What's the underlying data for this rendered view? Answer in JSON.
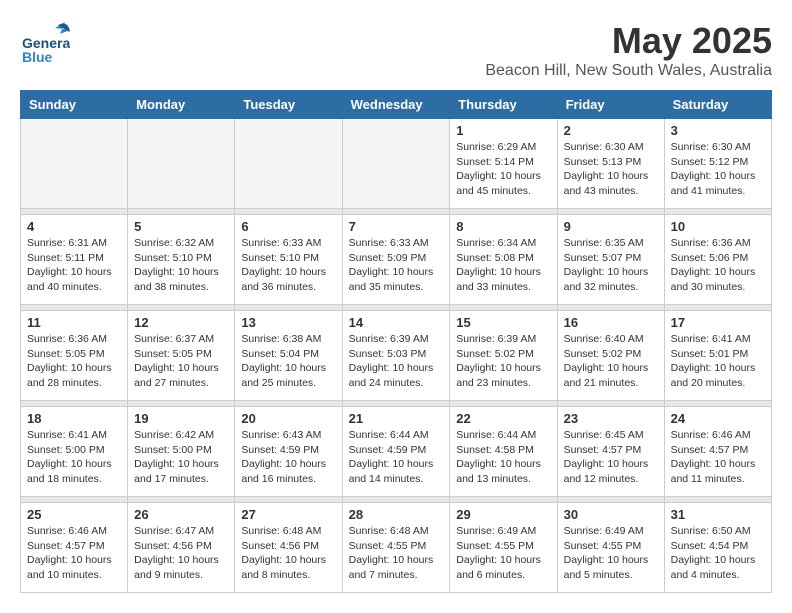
{
  "header": {
    "logo": {
      "line1": "General",
      "line2": "Blue"
    },
    "title": "May 2025",
    "location": "Beacon Hill, New South Wales, Australia"
  },
  "weekdays": [
    "Sunday",
    "Monday",
    "Tuesday",
    "Wednesday",
    "Thursday",
    "Friday",
    "Saturday"
  ],
  "weeks": [
    [
      {
        "day": "",
        "info": ""
      },
      {
        "day": "",
        "info": ""
      },
      {
        "day": "",
        "info": ""
      },
      {
        "day": "",
        "info": ""
      },
      {
        "day": "1",
        "info": "Sunrise: 6:29 AM\nSunset: 5:14 PM\nDaylight: 10 hours\nand 45 minutes."
      },
      {
        "day": "2",
        "info": "Sunrise: 6:30 AM\nSunset: 5:13 PM\nDaylight: 10 hours\nand 43 minutes."
      },
      {
        "day": "3",
        "info": "Sunrise: 6:30 AM\nSunset: 5:12 PM\nDaylight: 10 hours\nand 41 minutes."
      }
    ],
    [
      {
        "day": "4",
        "info": "Sunrise: 6:31 AM\nSunset: 5:11 PM\nDaylight: 10 hours\nand 40 minutes."
      },
      {
        "day": "5",
        "info": "Sunrise: 6:32 AM\nSunset: 5:10 PM\nDaylight: 10 hours\nand 38 minutes."
      },
      {
        "day": "6",
        "info": "Sunrise: 6:33 AM\nSunset: 5:10 PM\nDaylight: 10 hours\nand 36 minutes."
      },
      {
        "day": "7",
        "info": "Sunrise: 6:33 AM\nSunset: 5:09 PM\nDaylight: 10 hours\nand 35 minutes."
      },
      {
        "day": "8",
        "info": "Sunrise: 6:34 AM\nSunset: 5:08 PM\nDaylight: 10 hours\nand 33 minutes."
      },
      {
        "day": "9",
        "info": "Sunrise: 6:35 AM\nSunset: 5:07 PM\nDaylight: 10 hours\nand 32 minutes."
      },
      {
        "day": "10",
        "info": "Sunrise: 6:36 AM\nSunset: 5:06 PM\nDaylight: 10 hours\nand 30 minutes."
      }
    ],
    [
      {
        "day": "11",
        "info": "Sunrise: 6:36 AM\nSunset: 5:05 PM\nDaylight: 10 hours\nand 28 minutes."
      },
      {
        "day": "12",
        "info": "Sunrise: 6:37 AM\nSunset: 5:05 PM\nDaylight: 10 hours\nand 27 minutes."
      },
      {
        "day": "13",
        "info": "Sunrise: 6:38 AM\nSunset: 5:04 PM\nDaylight: 10 hours\nand 25 minutes."
      },
      {
        "day": "14",
        "info": "Sunrise: 6:39 AM\nSunset: 5:03 PM\nDaylight: 10 hours\nand 24 minutes."
      },
      {
        "day": "15",
        "info": "Sunrise: 6:39 AM\nSunset: 5:02 PM\nDaylight: 10 hours\nand 23 minutes."
      },
      {
        "day": "16",
        "info": "Sunrise: 6:40 AM\nSunset: 5:02 PM\nDaylight: 10 hours\nand 21 minutes."
      },
      {
        "day": "17",
        "info": "Sunrise: 6:41 AM\nSunset: 5:01 PM\nDaylight: 10 hours\nand 20 minutes."
      }
    ],
    [
      {
        "day": "18",
        "info": "Sunrise: 6:41 AM\nSunset: 5:00 PM\nDaylight: 10 hours\nand 18 minutes."
      },
      {
        "day": "19",
        "info": "Sunrise: 6:42 AM\nSunset: 5:00 PM\nDaylight: 10 hours\nand 17 minutes."
      },
      {
        "day": "20",
        "info": "Sunrise: 6:43 AM\nSunset: 4:59 PM\nDaylight: 10 hours\nand 16 minutes."
      },
      {
        "day": "21",
        "info": "Sunrise: 6:44 AM\nSunset: 4:59 PM\nDaylight: 10 hours\nand 14 minutes."
      },
      {
        "day": "22",
        "info": "Sunrise: 6:44 AM\nSunset: 4:58 PM\nDaylight: 10 hours\nand 13 minutes."
      },
      {
        "day": "23",
        "info": "Sunrise: 6:45 AM\nSunset: 4:57 PM\nDaylight: 10 hours\nand 12 minutes."
      },
      {
        "day": "24",
        "info": "Sunrise: 6:46 AM\nSunset: 4:57 PM\nDaylight: 10 hours\nand 11 minutes."
      }
    ],
    [
      {
        "day": "25",
        "info": "Sunrise: 6:46 AM\nSunset: 4:57 PM\nDaylight: 10 hours\nand 10 minutes."
      },
      {
        "day": "26",
        "info": "Sunrise: 6:47 AM\nSunset: 4:56 PM\nDaylight: 10 hours\nand 9 minutes."
      },
      {
        "day": "27",
        "info": "Sunrise: 6:48 AM\nSunset: 4:56 PM\nDaylight: 10 hours\nand 8 minutes."
      },
      {
        "day": "28",
        "info": "Sunrise: 6:48 AM\nSunset: 4:55 PM\nDaylight: 10 hours\nand 7 minutes."
      },
      {
        "day": "29",
        "info": "Sunrise: 6:49 AM\nSunset: 4:55 PM\nDaylight: 10 hours\nand 6 minutes."
      },
      {
        "day": "30",
        "info": "Sunrise: 6:49 AM\nSunset: 4:55 PM\nDaylight: 10 hours\nand 5 minutes."
      },
      {
        "day": "31",
        "info": "Sunrise: 6:50 AM\nSunset: 4:54 PM\nDaylight: 10 hours\nand 4 minutes."
      }
    ]
  ]
}
